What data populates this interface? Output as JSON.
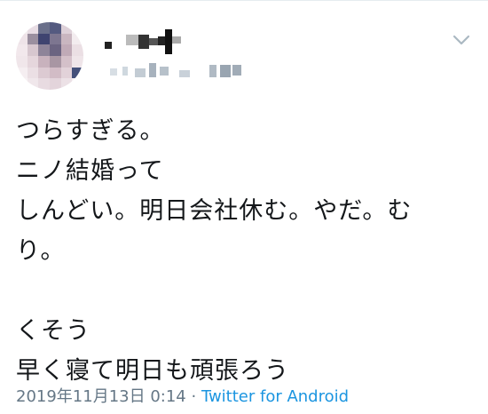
{
  "tweet": {
    "display_name": "",
    "handle": "",
    "lines": [
      "つらすぎる。",
      "ニノ結婚って",
      "しんどい。明日会社休む。やだ。む",
      "り。",
      "",
      "くそう",
      "早く寝て明日も頑張ろう"
    ],
    "timestamp": "2019年11月13日 0:14",
    "separator": " · ",
    "source": "Twitter for Android"
  },
  "icons": {
    "avatar": "avatar",
    "menu": "chevron-down-icon"
  },
  "colors": {
    "text": "#14171a",
    "meta": "#657786",
    "link": "#1b95e0",
    "chevron": "#aab8c2"
  }
}
